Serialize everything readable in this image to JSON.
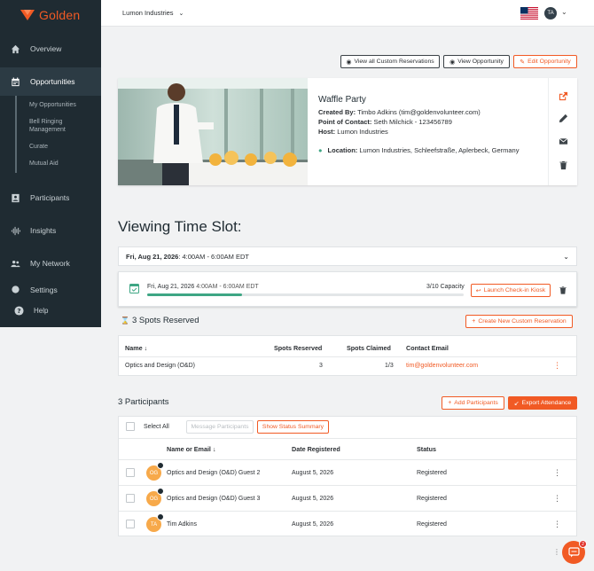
{
  "brand": {
    "name": "Golden",
    "accent": "#f15a24"
  },
  "sidebar": {
    "items": [
      {
        "label": "Overview",
        "icon": "home-icon"
      },
      {
        "label": "Opportunities",
        "icon": "calendar-icon"
      },
      {
        "label": "Participants",
        "icon": "id-card-icon"
      },
      {
        "label": "Insights",
        "icon": "waveform-icon"
      },
      {
        "label": "My Network",
        "icon": "people-icon"
      },
      {
        "label": "Settings",
        "icon": "gear-icon"
      }
    ],
    "subitems": [
      "My Opportunities",
      "Bell Ringing Management",
      "Curate",
      "Mutual Aid"
    ],
    "help": "Help"
  },
  "topbar": {
    "org": "Lumon Industries",
    "user_initials": "TA"
  },
  "actions": {
    "view_all": "View all Custom Reservations",
    "view_opportunity": "View Opportunity",
    "edit_opportunity": "Edit Opportunity"
  },
  "event": {
    "title": "Waffle Party",
    "created_by_label": "Created By:",
    "created_by": "Timbo Adkins (tim@goldenvolunteer.com)",
    "poc_label": "Point of Contact:",
    "poc": "Seth Milchick - 123456789",
    "host_label": "Host:",
    "host": "Lumon Industries",
    "location_label": "Location:",
    "location": "Lumon Industries, Schleefstraße, Aplerbeck, Germany"
  },
  "timeslot": {
    "heading": "Viewing Time Slot:",
    "select_date": "Fri, Aug 21, 2026",
    "select_time": ": 4:00AM - 6:00AM EDT",
    "panel_date": "Fri, Aug 21, 2026",
    "panel_time": "4:00AM - 6:00AM EDT",
    "capacity": "3/10 Capacity",
    "progress": 0.3,
    "kiosk": "Launch Check-in Kiosk"
  },
  "reservations": {
    "title": "3 Spots Reserved",
    "create": "Create New Custom Reservation",
    "headers": {
      "name": "Name",
      "reserved": "Spots Reserved",
      "claimed": "Spots Claimed",
      "email": "Contact Email"
    },
    "rows": [
      {
        "name": "Optics and Design (O&D)",
        "reserved": "3",
        "claimed": "1/3",
        "email": "tim@goldenvolunteer.com"
      }
    ]
  },
  "participants": {
    "title": "3 Participants",
    "add": "Add Participants",
    "export": "Export Attendance",
    "select_all": "Select All",
    "message": "Message Participants",
    "status_summary": "Show Status Summary",
    "headers": {
      "name": "Name or Email",
      "date": "Date Registered",
      "status": "Status"
    },
    "rows": [
      {
        "initials": "OG",
        "name": "Optics and Design (O&D) Guest 2",
        "date": "August 5, 2026",
        "status": "Registered"
      },
      {
        "initials": "OG",
        "name": "Optics and Design (O&D) Guest 3",
        "date": "August 5, 2026",
        "status": "Registered"
      },
      {
        "initials": "TA",
        "name": "Tim Adkins",
        "date": "August 5, 2026",
        "status": "Registered"
      }
    ]
  },
  "chat": {
    "badge": "2"
  }
}
